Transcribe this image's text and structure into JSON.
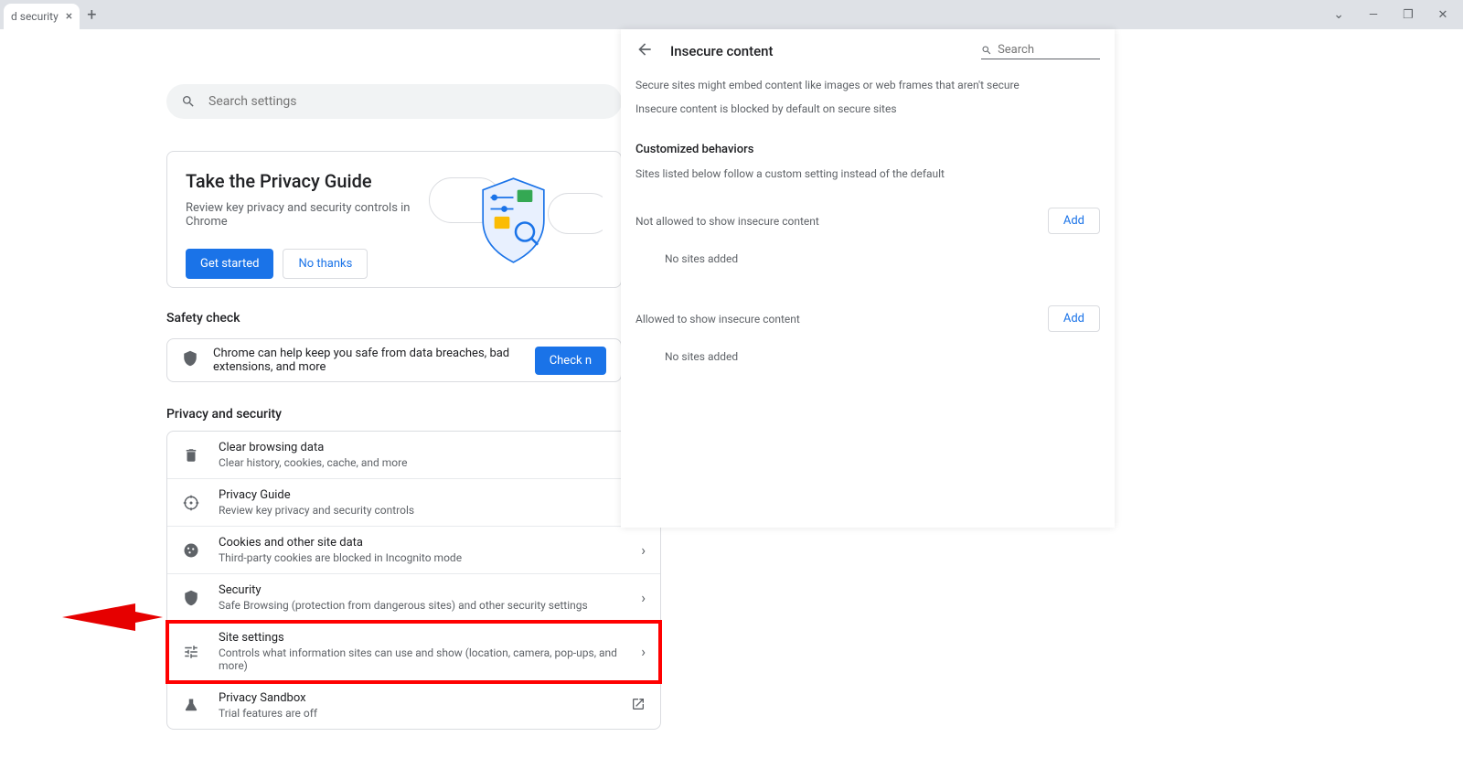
{
  "tab": {
    "title": "d security"
  },
  "search": {
    "placeholder": "Search settings"
  },
  "guide": {
    "title": "Take the Privacy Guide",
    "sub": "Review key privacy and security controls in Chrome",
    "get_started": "Get started",
    "no_thanks": "No thanks"
  },
  "safety": {
    "header": "Safety check",
    "text": "Chrome can help keep you safe from data breaches, bad extensions, and more",
    "check_btn": "Check n"
  },
  "privacy": {
    "header": "Privacy and security",
    "items": [
      {
        "title": "Clear browsing data",
        "sub": "Clear history, cookies, cache, and more"
      },
      {
        "title": "Privacy Guide",
        "sub": "Review key privacy and security controls"
      },
      {
        "title": "Cookies and other site data",
        "sub": "Third-party cookies are blocked in Incognito mode"
      },
      {
        "title": "Security",
        "sub": "Safe Browsing (protection from dangerous sites) and other security settings"
      },
      {
        "title": "Site settings",
        "sub": "Controls what information sites can use and show (location, camera, pop-ups, and more)"
      },
      {
        "title": "Privacy Sandbox",
        "sub": "Trial features are off"
      }
    ]
  },
  "panel": {
    "title": "Insecure content",
    "search_placeholder": "Search",
    "desc1": "Secure sites might embed content like images or web frames that aren't secure",
    "desc2": "Insecure content is blocked by default on secure sites",
    "custom_h": "Customized behaviors",
    "custom_sub": "Sites listed below follow a custom setting instead of the default",
    "not_allowed": "Not allowed to show insecure content",
    "allowed": "Allowed to show insecure content",
    "add": "Add",
    "no_sites": "No sites added"
  }
}
